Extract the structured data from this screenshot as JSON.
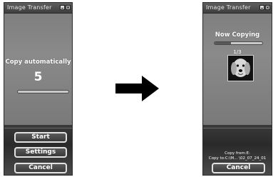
{
  "before_window": {
    "title": "Image Transfer",
    "heading": "Copy automatically",
    "countdown": "5",
    "progress_fraction": 0.0,
    "buttons": {
      "start": "Start",
      "settings": "Settings",
      "cancel": "Cancel"
    }
  },
  "after_window": {
    "title": "Image Transfer",
    "heading": "Now Copying",
    "progress_fraction": 0.35,
    "counter": "1/3",
    "copy_from": "Copy from:E:",
    "copy_to": "Copy to:C:\\M... \\02_07_24_01",
    "buttons": {
      "cancel": "Cancel"
    }
  },
  "icons": {
    "arrow": "right-arrow-icon",
    "minimize": "minimize-icon",
    "close": "close-icon",
    "thumbnail": "dog-photo-thumbnail"
  },
  "colors": {
    "window_bg": "#7c7c7c",
    "button_border": "#e2e2e2",
    "text": "#ffffff"
  }
}
